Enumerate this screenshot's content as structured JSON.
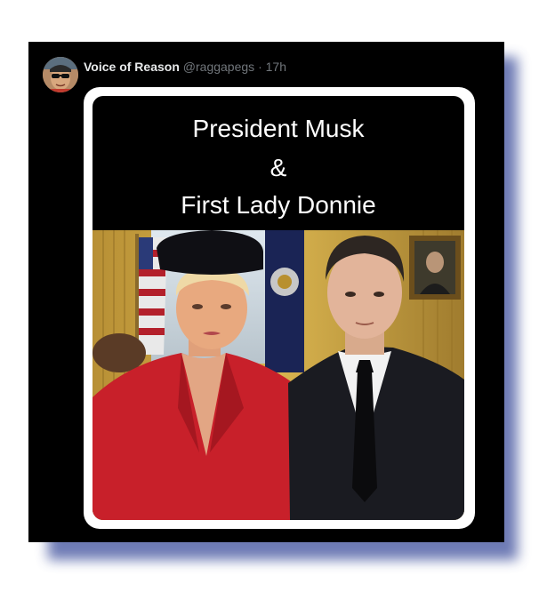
{
  "post": {
    "author_name": "Voice of Reason",
    "handle": "@raggapegs",
    "separator": "·",
    "time": "17h"
  },
  "media": {
    "caption_line1": "President Musk",
    "caption_line2": "&",
    "caption_line3": "First Lady Donnie"
  },
  "colors": {
    "card_background": "#000000",
    "shadow": "#5564a8",
    "author_text": "#e7e9ea",
    "meta_text": "#71767b",
    "red_jacket": "#c8202a"
  },
  "icons": {
    "avatar": "profile-avatar-sunglasses"
  }
}
